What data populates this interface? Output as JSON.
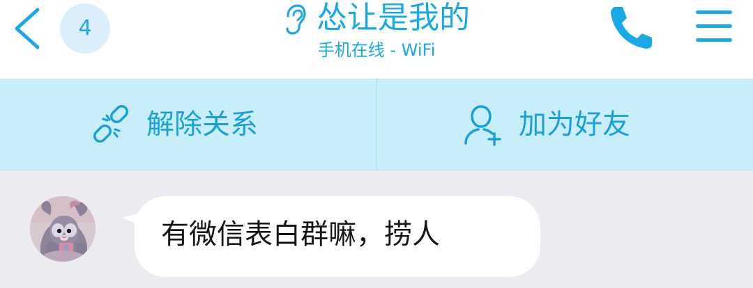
{
  "header": {
    "back_icon": "chevron-left-icon",
    "unread_count": "4",
    "title_icon": "ear-icon",
    "title": "怂让是我的",
    "subtitle": "手机在线 - WiFi",
    "phone_icon": "phone-icon",
    "menu_icon": "hamburger-menu-icon"
  },
  "actions": [
    {
      "icon": "unlink-icon",
      "label": "解除关系"
    },
    {
      "icon": "add-friend-icon",
      "label": "加为好友"
    }
  ],
  "chat": {
    "messages": [
      {
        "direction": "incoming",
        "avatar": "avatar-image",
        "text": "有微信表白群嘛，捞人"
      }
    ]
  },
  "colors": {
    "accent": "#19a9e6",
    "header_bg": "#ffffff",
    "action_bar_bg": "#c8eefb",
    "chat_bg": "#ebebf0",
    "bubble_bg": "#ffffff",
    "message_text": "#161616"
  }
}
